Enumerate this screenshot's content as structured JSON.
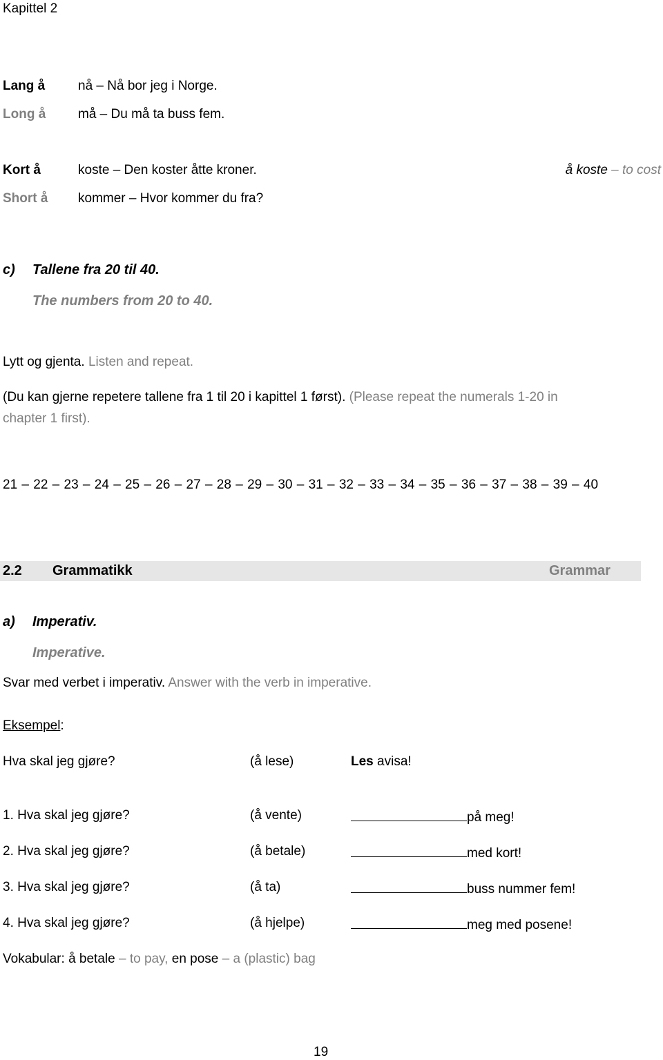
{
  "header": {
    "chapter": "Kapittel 2"
  },
  "vowels": {
    "long": {
      "label_no": "Lang å",
      "label_en": "Long å",
      "examples": [
        "nå – Nå bor jeg i Norge.",
        "må – Du må ta buss fem."
      ]
    },
    "short": {
      "label_no": "Kort å",
      "label_en": "Short å",
      "examples": [
        "koste – Den koster åtte kroner.",
        "kommer – Hvor kommer du fra?"
      ],
      "gloss_term": "å koste",
      "gloss_sep": " – ",
      "gloss_en": "to cost"
    }
  },
  "numbers": {
    "marker": "c)",
    "title_no": "Tallene fra 20 til 40.",
    "title_en": "The numbers from 20 to 40.",
    "instruction_no": "Lytt og gjenta.",
    "instruction_en": "Listen and repeat.",
    "note_no": "(Du kan gjerne repetere tallene fra 1 til 20 i kapittel 1 først).",
    "note_en_1": "(Please repeat the numerals 1-20 in",
    "note_en_2": "chapter 1 first).",
    "sequence": "21 – 22 – 23 – 24 – 25 – 26 – 27 – 28 – 29 – 30 – 31 – 32 – 33 – 34 – 35 – 36 – 37 – 38 – 39 – 40"
  },
  "section": {
    "number": "2.2",
    "title_no": "Grammatikk",
    "title_en": "Grammar"
  },
  "imperative": {
    "marker": "a)",
    "title_no": "Imperativ.",
    "title_en": "Imperative.",
    "instruction_no": "Svar med verbet i imperativ.",
    "instruction_en": "Answer with the verb in imperative.",
    "example_label": "Eksempel",
    "example_colon": ":",
    "example": {
      "question": "Hva skal jeg gjøre?",
      "verb": "(å lese)",
      "answer_bold": "Les",
      "answer_rest": " avisa!"
    },
    "exercises": [
      {
        "question": "1. Hva skal jeg gjøre?",
        "verb": "(å vente)",
        "blank": "",
        "rest": "på meg!"
      },
      {
        "question": "2. Hva skal jeg gjøre?",
        "verb": "(å betale)",
        "blank": "",
        "rest": "med kort!"
      },
      {
        "question": "3. Hva skal jeg gjøre?",
        "verb": "(å ta)",
        "blank": "",
        "rest": "buss nummer fem!"
      },
      {
        "question": "4. Hva skal jeg gjøre?",
        "verb": "(å hjelpe)",
        "blank": "",
        "rest": "meg med posene!"
      }
    ],
    "vocab": {
      "label": "Vokabular: ",
      "term1": "å betale",
      "sep1": " – ",
      "def1": "to pay,",
      "term2": " en pose",
      "sep2": " – ",
      "def2": "a (plastic) bag"
    }
  },
  "footer": {
    "page_number": "19"
  }
}
